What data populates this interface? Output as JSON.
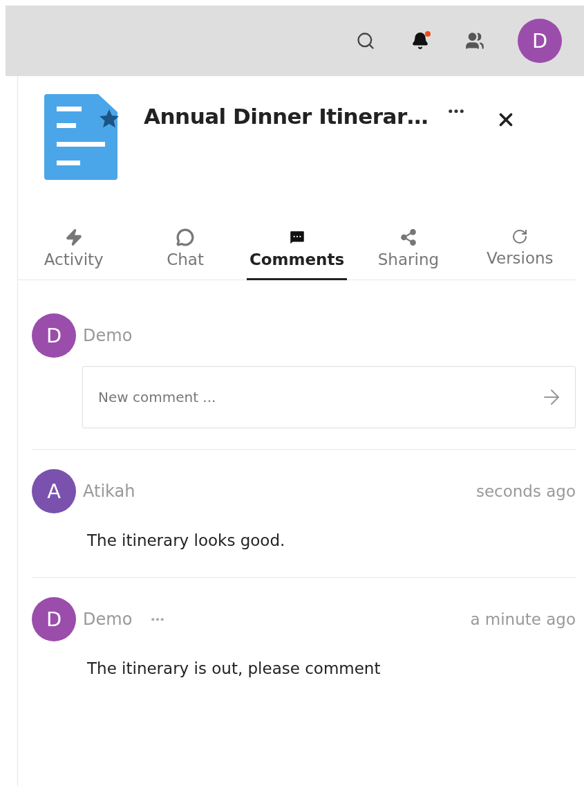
{
  "header": {
    "avatar": {
      "initial": "D",
      "color": "#9b4dab"
    },
    "notification_unread": true
  },
  "file": {
    "title": "Annual Dinner Itinerar…",
    "favorite": true
  },
  "tabs": [
    {
      "label": "Activity",
      "kind": "activity",
      "selected": false
    },
    {
      "label": "Chat",
      "kind": "chat",
      "selected": false
    },
    {
      "label": "Comments",
      "kind": "comments",
      "selected": true
    },
    {
      "label": "Sharing",
      "kind": "sharing",
      "selected": false
    },
    {
      "label": "Versions",
      "kind": "versions",
      "selected": false
    }
  ],
  "composer": {
    "initial": "D",
    "author": "Demo",
    "color": "#9b4dab",
    "placeholder": "New comment ..."
  },
  "comments": [
    {
      "initial": "A",
      "author": "Atikah",
      "color": "#7a52ad",
      "time": "seconds ago",
      "text": "The itinerary looks good.",
      "menu_visible": false
    },
    {
      "initial": "D",
      "author": "Demo",
      "color": "#9b4dab",
      "time": "a minute ago",
      "text": "The itinerary is out, please comment",
      "menu_visible": true
    }
  ]
}
